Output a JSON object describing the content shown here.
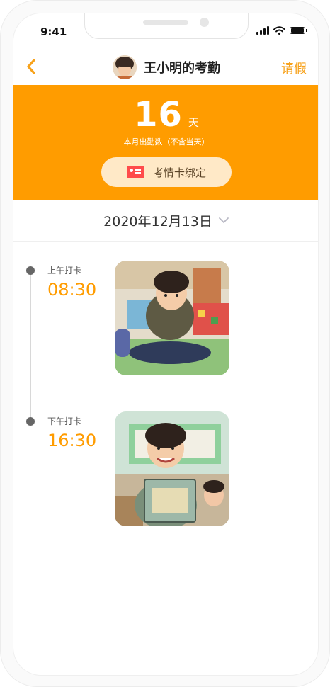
{
  "status_bar": {
    "time": "9:41"
  },
  "header": {
    "title": "王小明的考勤",
    "leave_label": "请假"
  },
  "summary": {
    "days": "16",
    "unit": "天",
    "caption": "本月出勤数（不含当天）",
    "bind_card_label": "考情卡绑定"
  },
  "date_selector": {
    "date": "2020年12月13日"
  },
  "records": [
    {
      "label": "上午打卡",
      "time": "08:30"
    },
    {
      "label": "下午打卡",
      "time": "16:30"
    }
  ],
  "colors": {
    "accent": "#ff9c00",
    "banner": "#ff9c00",
    "card_button_bg": "#ffe9c7",
    "card_icon": "#ff4b4b",
    "leave_text": "#f7a21b"
  },
  "icons": [
    "back-chevron-icon",
    "signal-icon",
    "wifi-icon",
    "battery-icon",
    "card-icon",
    "chevron-down-icon"
  ]
}
